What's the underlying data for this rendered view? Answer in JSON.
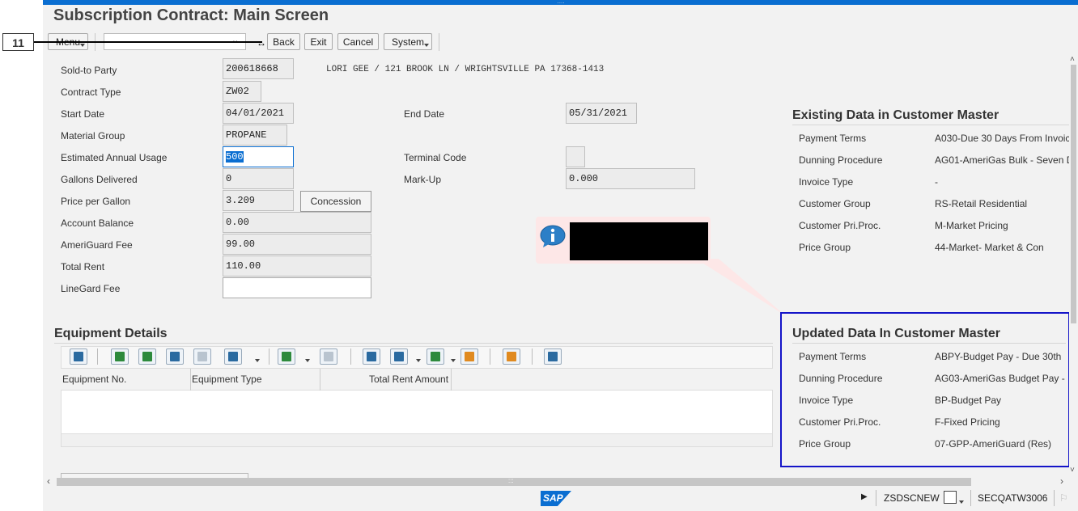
{
  "window": {
    "title": "Subscription Contract: Main Screen"
  },
  "step_marker": "11",
  "toolbar": {
    "menu_label": "Menu",
    "back_label": "Back",
    "exit_label": "Exit",
    "cancel_label": "Cancel",
    "system_label": "System"
  },
  "form": {
    "sold_to_party": {
      "label": "Sold-to Party",
      "value": "200618668"
    },
    "address": "LORI GEE / 121 BROOK LN / WRIGHTSVILLE PA 17368-1413",
    "contract_type": {
      "label": "Contract Type",
      "value": "ZW02"
    },
    "start_date": {
      "label": "Start Date",
      "value": "04/01/2021"
    },
    "end_date": {
      "label": "End Date",
      "value": "05/31/2021"
    },
    "material_group": {
      "label": "Material Group",
      "value": "PROPANE"
    },
    "estimated_annual_usage": {
      "label": "Estimated Annual Usage",
      "value": "500"
    },
    "terminal_code": {
      "label": "Terminal Code",
      "value": ""
    },
    "gallons_delivered": {
      "label": "Gallons Delivered",
      "value": "0"
    },
    "mark_up": {
      "label": "Mark-Up",
      "value": "0.000"
    },
    "price_per_gallon": {
      "label": "Price per Gallon",
      "value": "3.209"
    },
    "concession_label": "Concession",
    "account_balance": {
      "label": "Account Balance",
      "value": "0.00"
    },
    "ameriguard_fee": {
      "label": "AmeriGuard Fee",
      "value": "99.00"
    },
    "total_rent": {
      "label": "Total Rent",
      "value": "110.00"
    },
    "linegard_fee": {
      "label": "LineGard Fee",
      "value": ""
    }
  },
  "existing_data": {
    "title": "Existing Data in Customer Master",
    "rows": [
      {
        "label": "Payment Terms",
        "value": "A030-Due 30 Days From Invoic"
      },
      {
        "label": "Dunning Procedure",
        "value": "AG01-AmeriGas Bulk - Seven D"
      },
      {
        "label": "Invoice Type",
        "value": "-"
      },
      {
        "label": "Customer Group",
        "value": "RS-Retail Residential"
      },
      {
        "label": "Customer Pri.Proc.",
        "value": "M-Market Pricing"
      },
      {
        "label": "Price Group",
        "value": "44-Market- Market & Con"
      }
    ]
  },
  "updated_data": {
    "title": "Updated Data In Customer Master",
    "rows": [
      {
        "label": "Payment Terms",
        "value": "ABPY-Budget Pay - Due 30th"
      },
      {
        "label": "Dunning Procedure",
        "value": "AG03-AmeriGas Budget Pay - E"
      },
      {
        "label": "Invoice Type",
        "value": "BP-Budget Pay"
      },
      {
        "label": "Customer Pri.Proc.",
        "value": "F-Fixed Pricing"
      },
      {
        "label": "Price Group",
        "value": "07-GPP-AmeriGuard (Res)"
      }
    ]
  },
  "equipment": {
    "title": "Equipment Details",
    "columns": [
      "Equipment No.",
      "Equipment Type",
      "Total Rent Amount"
    ]
  },
  "statusbar": {
    "logo": "SAP",
    "transaction": "ZSDSCNEW",
    "system": "SECQATW3006"
  },
  "colors": {
    "accent": "#0a6ed1",
    "highlight_box": "#1414c8",
    "popup_bg": "#fde7e7"
  }
}
